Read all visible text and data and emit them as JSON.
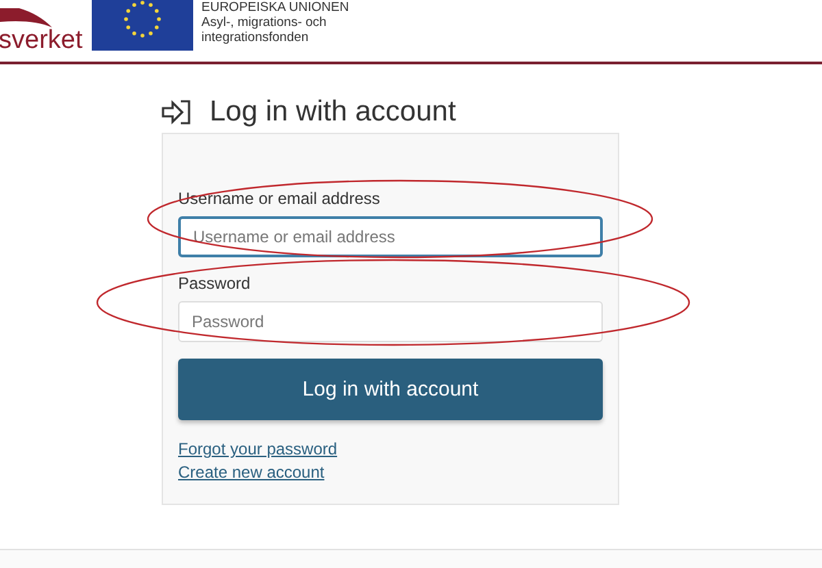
{
  "header": {
    "logo_text": "sverket",
    "eu_lines": [
      "EUROPEISKA UNIONEN",
      "Asyl-, migrations- och",
      "integrationsfonden"
    ]
  },
  "title": "Log in with account",
  "form": {
    "fields": [
      {
        "label": "Username or email address",
        "placeholder": "Username or email address",
        "focused": true
      },
      {
        "label": "Password",
        "placeholder": "Password",
        "focused": false
      }
    ],
    "submit": "Log in with account",
    "links": [
      "Forgot your password",
      "Create new account"
    ]
  },
  "annotations": [
    {
      "kind": "ellipse"
    },
    {
      "kind": "ellipse"
    }
  ]
}
